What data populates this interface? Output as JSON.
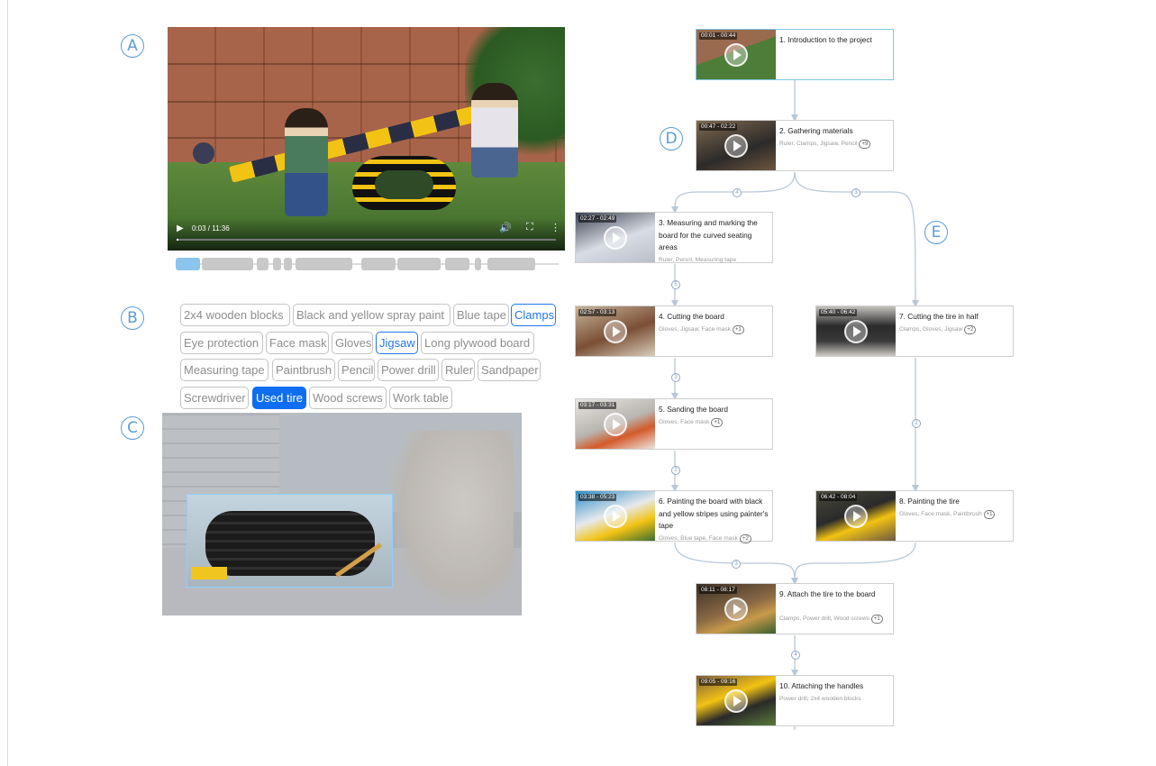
{
  "labels": {
    "a": "A",
    "b": "B",
    "c": "C",
    "d": "D",
    "e": "E"
  },
  "video": {
    "time": "0:03 / 11:36",
    "progress": 0.004
  },
  "tags": [
    {
      "label": "2x4 wooden blocks",
      "state": "normal"
    },
    {
      "label": "Black and yellow spray paint",
      "state": "normal"
    },
    {
      "label": "Blue tape",
      "state": "normal"
    },
    {
      "label": "Clamps",
      "state": "highlighted"
    },
    {
      "label": "Eye protection",
      "state": "normal"
    },
    {
      "label": "Face mask",
      "state": "normal"
    },
    {
      "label": "Gloves",
      "state": "normal"
    },
    {
      "label": "Jigsaw",
      "state": "highlighted"
    },
    {
      "label": "Long plywood board",
      "state": "normal"
    },
    {
      "label": "Measuring tape",
      "state": "normal"
    },
    {
      "label": "Paintbrush",
      "state": "normal"
    },
    {
      "label": "Pencil",
      "state": "normal"
    },
    {
      "label": "Power drill",
      "state": "normal"
    },
    {
      "label": "Ruler",
      "state": "normal"
    },
    {
      "label": "Sandpaper",
      "state": "normal"
    },
    {
      "label": "Screwdriver",
      "state": "normal"
    },
    {
      "label": "Used tire",
      "state": "selected"
    },
    {
      "label": "Wood screws",
      "state": "normal"
    },
    {
      "label": "Work table",
      "state": "normal"
    }
  ],
  "steps": [
    {
      "time": "00:01 - 00:44",
      "title": "1. Introduction to the project",
      "tools": "",
      "more": ""
    },
    {
      "time": "00:47 - 02:22",
      "title": "2. Gathering materials",
      "tools": "Ruler, Clamps, Jigsaw, Pencil",
      "more": "+9"
    },
    {
      "time": "02:27 - 02:49",
      "title": "3. Measuring and marking the board for the curved seating areas",
      "tools": "Ruler, Pencil, Measuring tape",
      "more": ""
    },
    {
      "time": "02:57 - 03:13",
      "title": "4. Cutting the board",
      "tools": "Gloves, Jigsaw, Face mask",
      "more": "+1"
    },
    {
      "time": "03:17 - 03:31",
      "title": "5. Sanding the board",
      "tools": "Gloves, Face mask",
      "more": "+1"
    },
    {
      "time": "03:38 - 05:23",
      "title": "6. Painting the board with black and yellow stripes using painter's tape",
      "tools": "Gloves, Blue tape, Face mask",
      "more": "+2"
    },
    {
      "time": "05:40 - 06:42",
      "title": "7. Cutting the tire in half",
      "tools": "Clamps, Gloves, Jigsaw",
      "more": "+2"
    },
    {
      "time": "06:42 - 08:04",
      "title": "8. Painting the tire",
      "tools": "Gloves, Face mask, Paintbrush",
      "more": "+1"
    },
    {
      "time": "08:11 - 08:17",
      "title": "9. Attach the tire to the board",
      "tools": "Clamps, Power drill, Wood screws",
      "more": "+1"
    },
    {
      "time": "09:05 - 09:16",
      "title": "10. Attaching the handles",
      "tools": "Power drill, 2x4 wooden blocks",
      "more": ""
    }
  ],
  "edge_badges": [
    "4",
    "3",
    "5",
    "3",
    "2",
    "2",
    "3",
    "4"
  ],
  "colors": {
    "accent": "#1f77ec",
    "selected": "#0f6ef0",
    "label": "#5b9bd5",
    "segment_active": "#8bc4ec"
  }
}
